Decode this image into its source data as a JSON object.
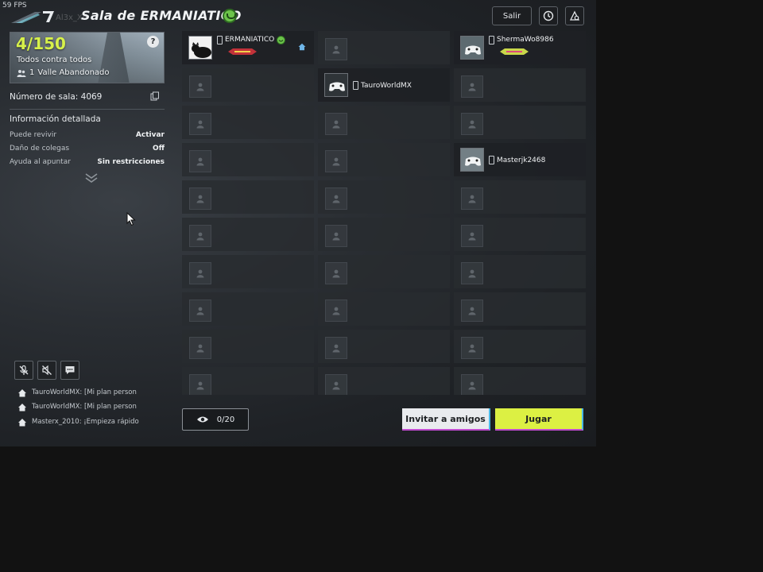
{
  "fps": "59 FPS",
  "header": {
    "ghost_name": "Al3x_Xd",
    "room_title": "Sala de ERMANIATICO",
    "exit_label": "Salir"
  },
  "room": {
    "player_count": "4/150",
    "mode": "Todos contra todos",
    "map_players": "1",
    "map_name": "Valle Abandonado",
    "room_number": "Número de sala: 4069",
    "details_title": "Información detallada",
    "options": [
      {
        "key": "Puede revivir",
        "value": "Activar"
      },
      {
        "key": "Daño de colegas",
        "value": "Off"
      },
      {
        "key": "Ayuda al apuntar",
        "value": "Sin restricciones"
      }
    ]
  },
  "chat": [
    "TauroWorldMX: [Mi plan person",
    "TauroWorldMX: [Mi plan person",
    "Masterx_2010: ¡Empieza rápido"
  ],
  "players": {
    "host": "ERMANIATICO",
    "p2": "ShermaWo8986",
    "p3": "TauroWorldMX",
    "p4": "Masterjk2468"
  },
  "spectators": "0/20",
  "buttons": {
    "invite": "Invitar a amigos",
    "play": "Jugar"
  },
  "colors": {
    "accent_yellow": "#dcf043",
    "count_yellow": "#d7f14a",
    "host_badge_green": "#6cc44a",
    "home_blue": "#6fb6e8"
  }
}
